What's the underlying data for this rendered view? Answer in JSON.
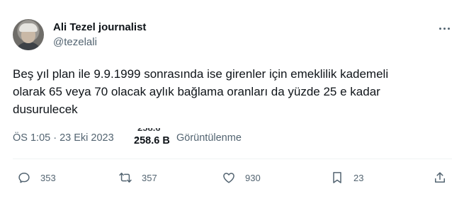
{
  "author": {
    "display_name": "Ali Tezel journalist",
    "handle": "@tezelali"
  },
  "tweet": {
    "text": "Beş yıl plan ile 9.9.1999 sonrasında ise girenler için emeklilik kademeli\nolarak 65 veya 70 olacak aylık bağlama oranları da yüzde 25 e kadar\ndusurulecek",
    "timestamp": "ÖS 1:05 · 23 Eki 2023",
    "separator": "·",
    "views_count": "258.6 B",
    "views_label": "Görüntülenme"
  },
  "actions": {
    "reply_count": "353",
    "retweet_count": "357",
    "like_count": "930",
    "bookmark_count": "23"
  },
  "colors": {
    "primary_text": "#0f1419",
    "secondary_text": "#536471",
    "divider": "#eff3f4"
  },
  "icons": [
    "more-icon",
    "reply-icon",
    "retweet-icon",
    "like-icon",
    "bookmark-icon",
    "share-icon"
  ]
}
